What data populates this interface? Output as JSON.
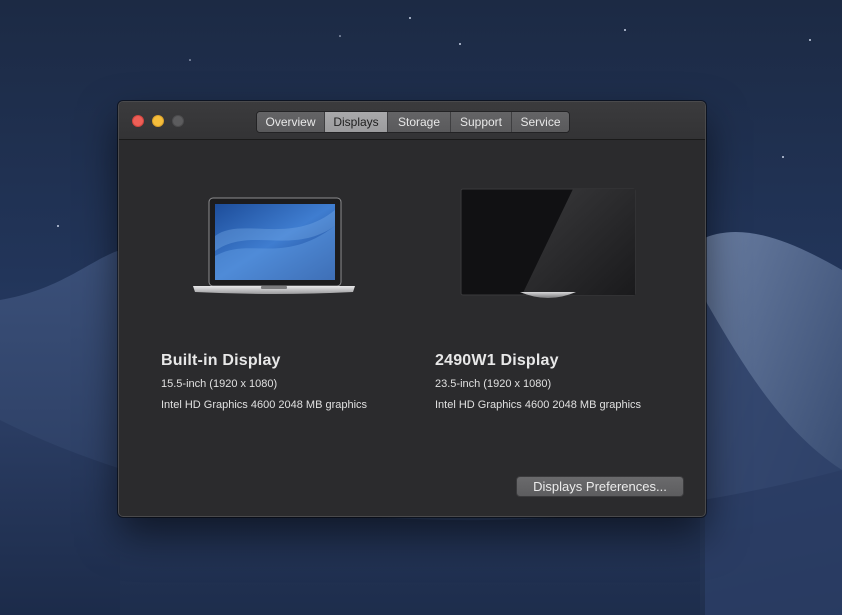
{
  "window": {
    "tabs": [
      {
        "label": "Overview",
        "active": false
      },
      {
        "label": "Displays",
        "active": true
      },
      {
        "label": "Storage",
        "active": false
      },
      {
        "label": "Support",
        "active": false
      },
      {
        "label": "Service",
        "active": false
      }
    ]
  },
  "displays": [
    {
      "name": "Built-in Display",
      "size": "15.5-inch (1920 x 1080)",
      "graphics": "Intel HD Graphics 4600 2048 MB graphics",
      "icon": "laptop-icon"
    },
    {
      "name": "2490W1 Display",
      "size": "23.5-inch (1920 x 1080)",
      "graphics": "Intel HD Graphics 4600 2048 MB graphics",
      "icon": "monitor-icon"
    }
  ],
  "actions": {
    "preferences_label": "Displays Preferences..."
  },
  "colors": {
    "close": "#ed5f57",
    "minimize": "#f5bd3c",
    "zoom_disabled": "#5c5c5e",
    "window_bg": "#2b2b2d"
  }
}
